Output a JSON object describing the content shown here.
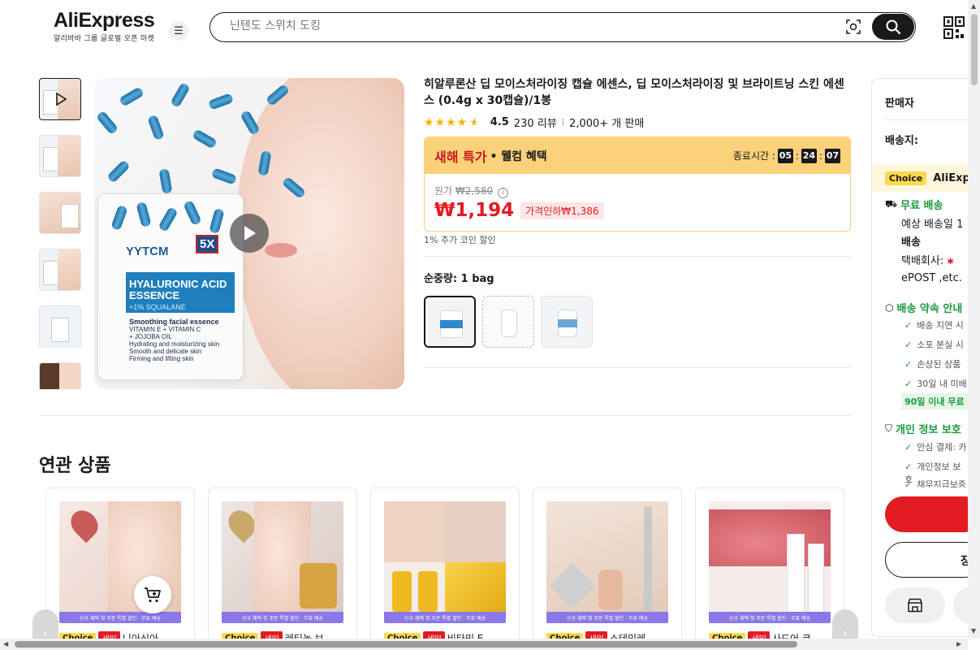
{
  "header": {
    "logo": "AliExpress",
    "logo_sub": "알리바바 그룹 글로벌 오픈 마켓",
    "search_placeholder": "닌텐도 스위치 도킹"
  },
  "product": {
    "title": "히알루론산 딥 모이스처라이징 캡슐 에센스, 딥 모이스처라이징 및 브라이트닝 스킨 에센스 (0.4g x 30캡슐)/1봉",
    "rating": "4.5",
    "reviews": "230 리뷰",
    "sold": "2,000+ 개 판매",
    "image_brand": "YYTCM",
    "image_badge": "5X",
    "image_band_title": "HYALURONIC ACID ESSENCE",
    "image_band_sub": "+1% SQUALANE",
    "image_line1": "Smoothing facial essence",
    "image_line2": "VITAMIN E + VITAMIN C",
    "image_line3": "+ JOJOBA OIL",
    "image_line4": "Hydrating and moisturizing skin",
    "image_line5": "Smooth and delicate skin",
    "image_line6": "Firming and lifting skin"
  },
  "promo": {
    "title": "새해 특가",
    "subtitle": "• 웰컴 혜택",
    "timer_label": "종료시간 :",
    "hours": "05",
    "minutes": "24",
    "seconds": "07",
    "orig_label": "원가",
    "orig_price": "₩2,580",
    "price": "₩1,194",
    "discount": "가격인하₩1,386",
    "coin": "1% 추가 코인 할인"
  },
  "options": {
    "label": "순중량:",
    "value": "1 bag"
  },
  "side": {
    "seller_label": "판매자",
    "ship_to_label": "배송지:",
    "choice_tag": "Choice",
    "choice_text": "AliExpr",
    "free_ship": "무료 배송",
    "eta_label": "예상 배송일 1",
    "eta_cont": "배송",
    "courier_label": "택배회사:",
    "courier_value": "ePOST ,etc.",
    "promise_title": "배송 약속 안내",
    "promise_items": [
      "배송 지연 시",
      "소포 분실 시",
      "손상된 상품",
      "30일 내 미배"
    ],
    "promise_pill": "90일 이내 무료",
    "privacy_title": "개인 정보 보호",
    "privacy_items": [
      "안심 결제: 카",
      "개인정보 보호",
      "채무지급보증"
    ],
    "cart_label": "장"
  },
  "related": {
    "title": "연관 상품",
    "banner": "신규 혜택 첫 주문 특별 할인 · 무료 배송",
    "choice_tag": "Choice",
    "sale_tag": "세일",
    "items": [
      "니아신아",
      "레티놀 브",
      "비타민 E",
      "스테인레",
      "사드어 코"
    ]
  },
  "colors": {
    "accent_red": "#e31b23",
    "promo_yellow": "#fbd27a",
    "choice_yellow": "#fad94a",
    "green": "#1a9a3b"
  }
}
